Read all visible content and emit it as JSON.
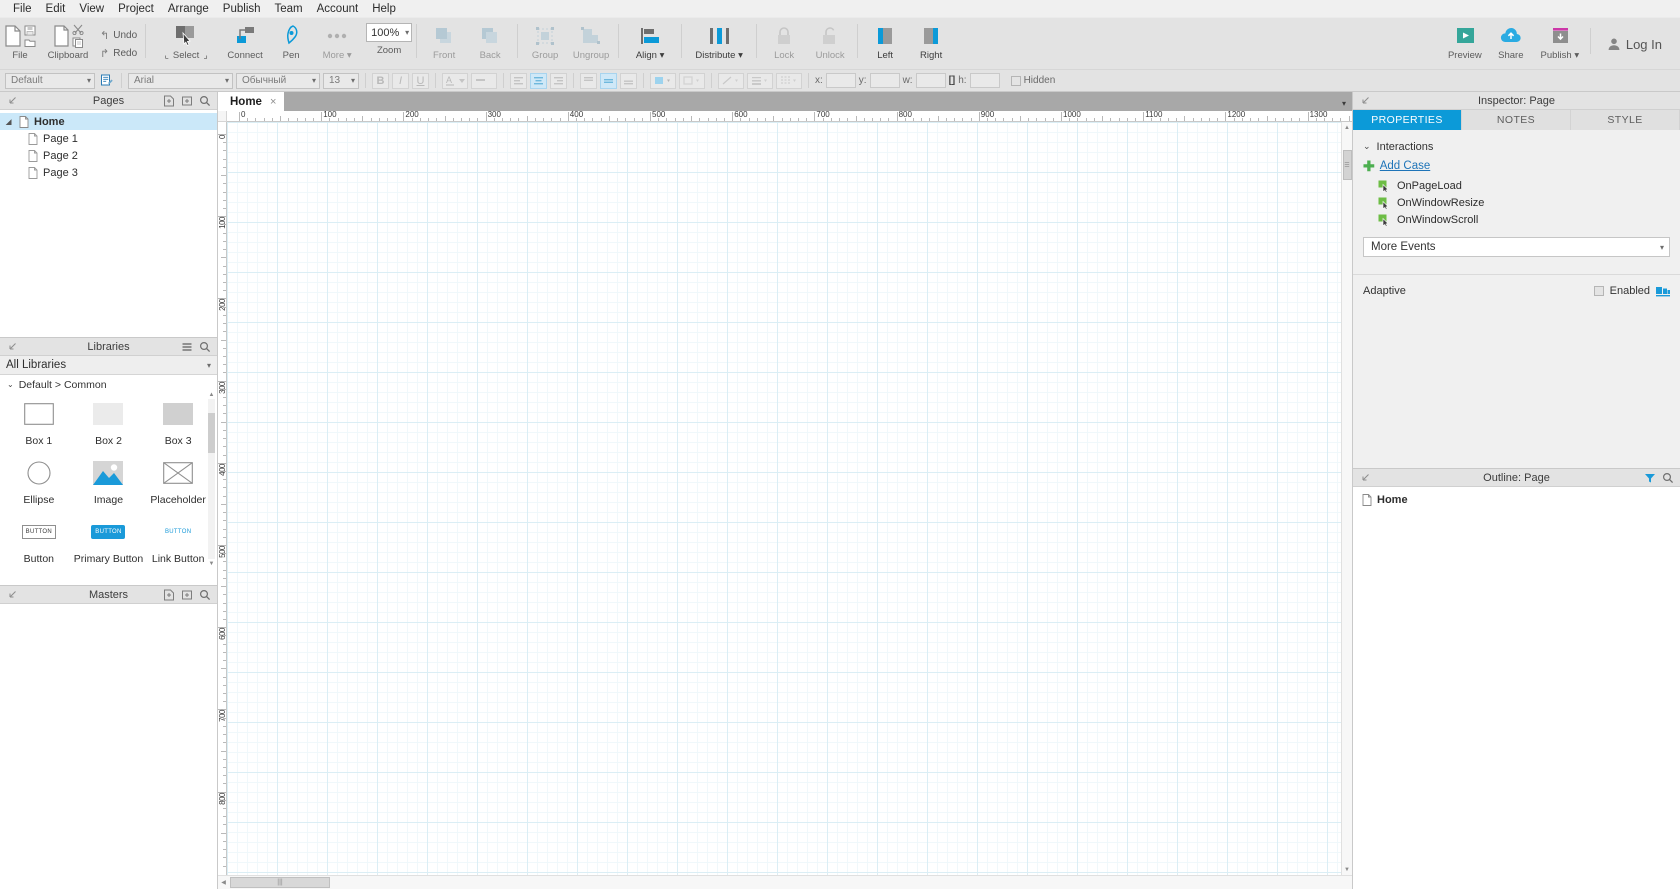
{
  "menubar": {
    "items": [
      "File",
      "Edit",
      "View",
      "Project",
      "Arrange",
      "Publish",
      "Team",
      "Account",
      "Help"
    ]
  },
  "toolbar": {
    "file_label": "File",
    "clipboard_label": "Clipboard",
    "undo_label": "Undo",
    "redo_label": "Redo",
    "select_label": "Select",
    "select_left_bracket": "⌞",
    "select_right_bracket": "⌟",
    "connect_label": "Connect",
    "pen_label": "Pen",
    "more_label": "More ▾",
    "zoom_value": "100%",
    "zoom_label": "Zoom",
    "front_label": "Front",
    "back_label": "Back",
    "group_label": "Group",
    "ungroup_label": "Ungroup",
    "align_label": "Align ▾",
    "distribute_label": "Distribute ▾",
    "lock_label": "Lock",
    "unlock_label": "Unlock",
    "left_label": "Left",
    "right_label": "Right",
    "preview_label": "Preview",
    "share_label": "Share",
    "publish_label": "Publish ▾",
    "login_label": "Log In"
  },
  "formatbar": {
    "style_value": "Default",
    "font_value": "Arial",
    "weight_value": "Обычный",
    "size_value": "13",
    "bold": "B",
    "italic": "I",
    "underline": "U",
    "x_label": "x:",
    "y_label": "y:",
    "w_label": "w:",
    "h_label": "h:",
    "x_value": "",
    "y_value": "",
    "w_value": "",
    "h_value": "",
    "hidden_label": "Hidden"
  },
  "pages": {
    "title": "Pages",
    "tree": [
      {
        "label": "Home",
        "level": 0,
        "selected": true
      },
      {
        "label": "Page 1",
        "level": 1,
        "selected": false
      },
      {
        "label": "Page 2",
        "level": 1,
        "selected": false
      },
      {
        "label": "Page 3",
        "level": 1,
        "selected": false
      }
    ]
  },
  "libraries": {
    "title": "Libraries",
    "selected_library": "All Libraries",
    "category": "Default > Common",
    "widgets": [
      {
        "name": "Box 1",
        "icon": "box-outline"
      },
      {
        "name": "Box 2",
        "icon": "box-light"
      },
      {
        "name": "Box 3",
        "icon": "box-dark"
      },
      {
        "name": "Ellipse",
        "icon": "ellipse"
      },
      {
        "name": "Image",
        "icon": "image"
      },
      {
        "name": "Placeholder",
        "icon": "placeholder"
      },
      {
        "name": "Button",
        "icon": "button-outline",
        "caption": "BUTTON"
      },
      {
        "name": "Primary Button",
        "icon": "button-primary",
        "caption": "BUTTON"
      },
      {
        "name": "Link Button",
        "icon": "button-link",
        "caption": "BUTTON"
      }
    ]
  },
  "masters": {
    "title": "Masters"
  },
  "canvas": {
    "tab_label": "Home",
    "tab_close": "×",
    "h_ruler_labels": [
      "0",
      "100",
      "200",
      "300",
      "400",
      "500",
      "600",
      "700",
      "800",
      "900",
      "1000",
      "1100",
      "1200",
      "1300"
    ],
    "v_ruler_labels": [
      "0",
      "100",
      "200",
      "300",
      "400",
      "500",
      "600",
      "700",
      "800"
    ]
  },
  "inspector": {
    "title": "Inspector: Page",
    "tabs": [
      {
        "label": "PROPERTIES",
        "active": true
      },
      {
        "label": "NOTES",
        "active": false
      },
      {
        "label": "STYLE",
        "active": false
      }
    ],
    "interactions_title": "Interactions",
    "add_case_label": "Add Case",
    "events": [
      "OnPageLoad",
      "OnWindowResize",
      "OnWindowScroll"
    ],
    "more_events_label": "More Events",
    "adaptive_label": "Adaptive",
    "adaptive_enabled_label": "Enabled",
    "adaptive_checked": false
  },
  "outline": {
    "title": "Outline: Page",
    "items": [
      "Home"
    ]
  },
  "colors": {
    "accent": "#0c9ad8",
    "link": "#1e74b8",
    "plus_green": "#4caf50",
    "toolbar_bg": "#e3e3e3",
    "selection": "#cbe8f9",
    "grid_line": "#dbeef5",
    "publish_magenta": "#cc37a8",
    "preview_teal": "#35a69a"
  }
}
